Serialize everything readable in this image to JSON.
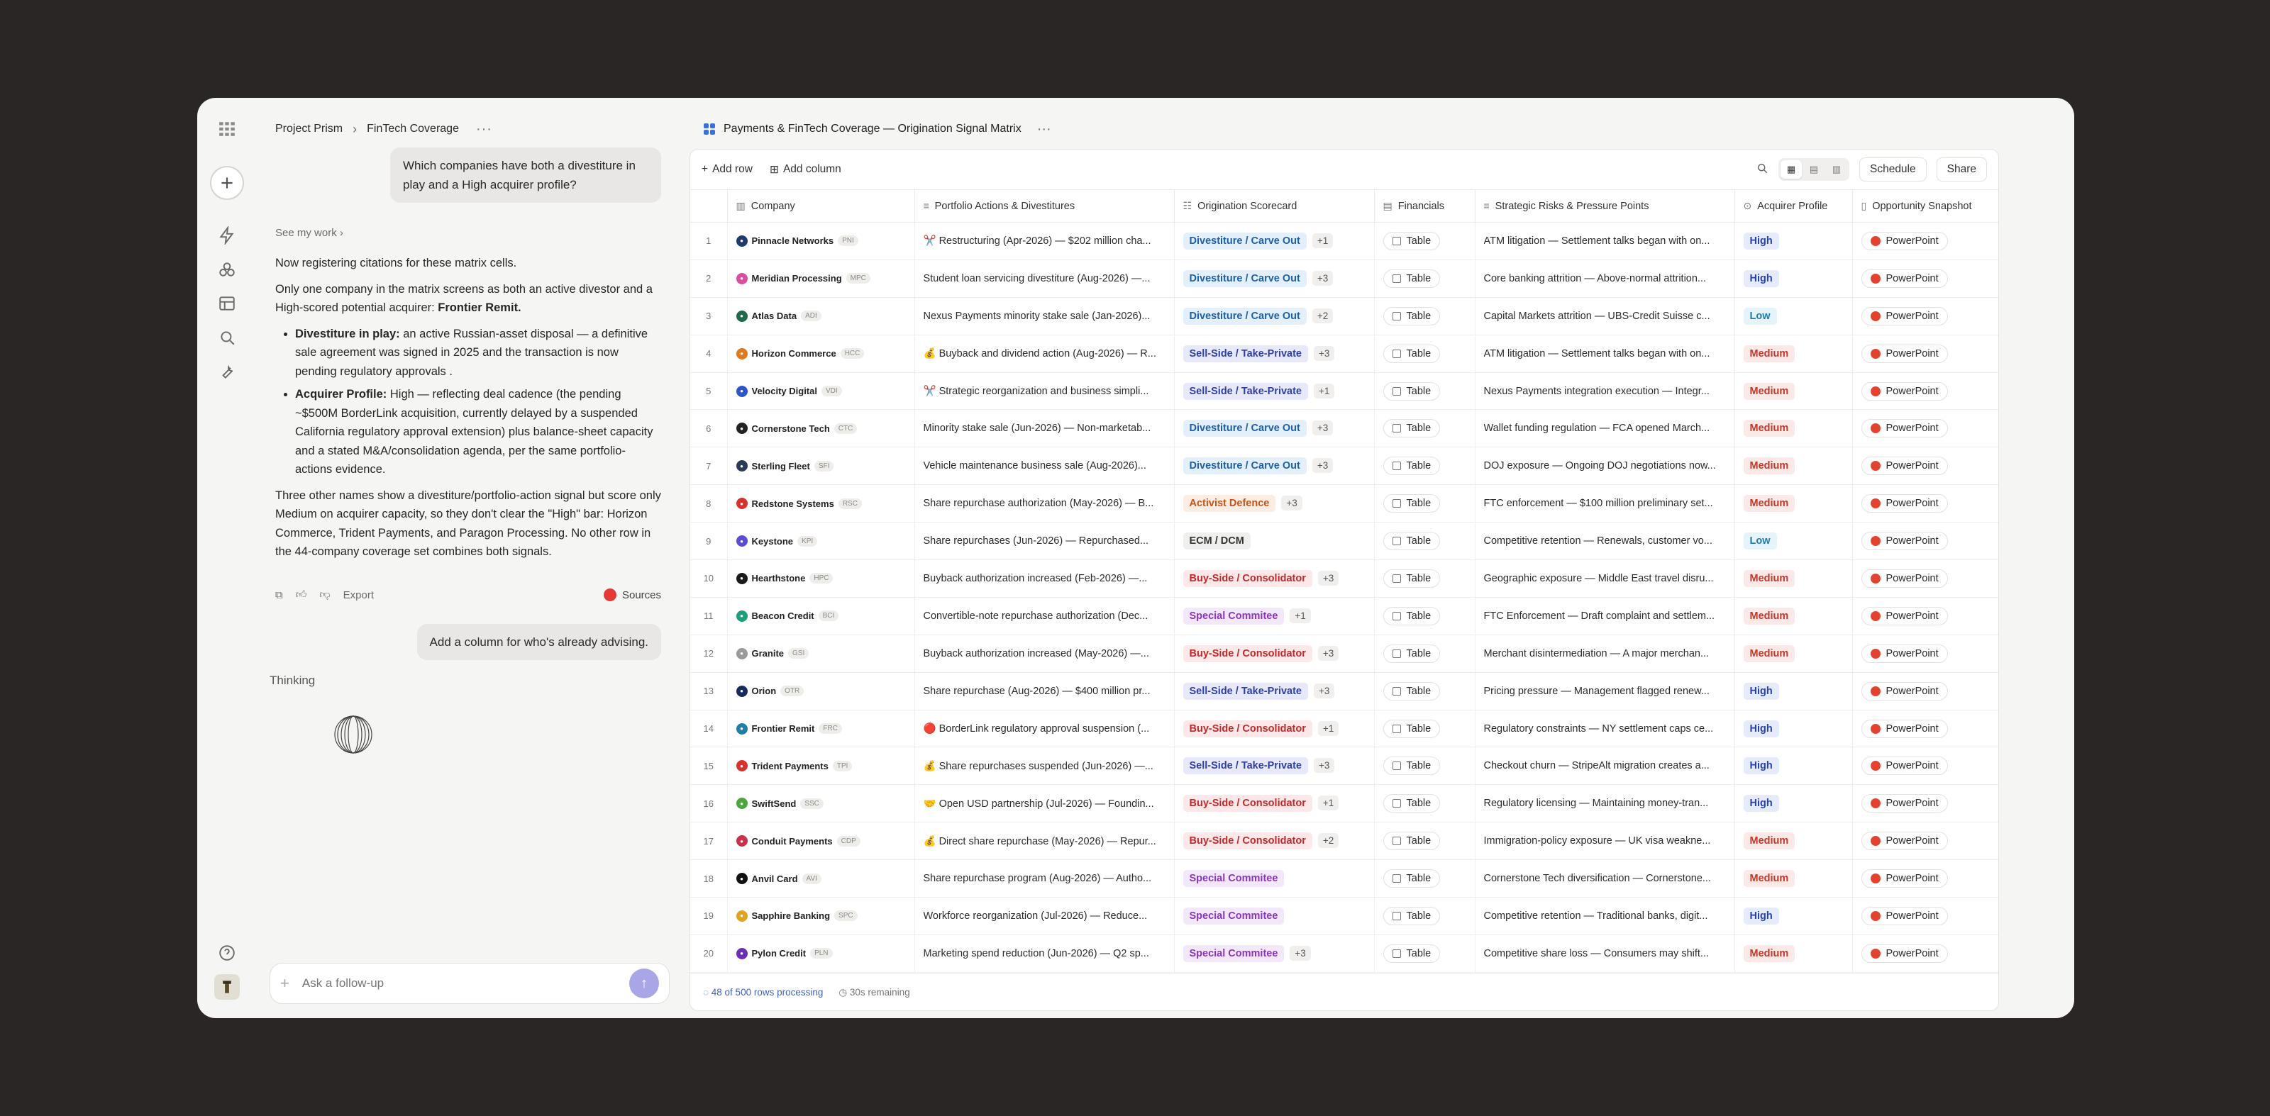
{
  "breadcrumb": {
    "project": "Project Prism",
    "page": "FinTech Coverage"
  },
  "chat": {
    "user_question": "Which companies have both a divestiture in play and a High acquirer profile?",
    "see_my_work": "See my work",
    "p1": "Now registering citations for these matrix cells.",
    "p2_pre": "Only one company in the matrix screens as both an active divestor and a High-scored potential acquirer: ",
    "p2_bold": "Frontier Remit.",
    "b1_bold": "Divestiture in play:",
    "b1_text": " an active Russian-asset disposal — a definitive sale agreement was signed in 2025 and the transaction is now pending regulatory approvals .",
    "b2_bold": "Acquirer Profile:",
    "b2_text": " High  — reflecting deal cadence (the pending ~$500M BorderLink acquisition, currently delayed by a suspended California regulatory approval extension) plus balance-sheet capacity and a stated M&A/consolidation agenda, per the same portfolio-actions evidence.",
    "p3": "Three other names show a divestiture/portfolio-action signal but score only Medium on acquirer capacity, so they don't clear the \"High\" bar: Horizon Commerce, Trident Payments, and Paragon Processing. No other row in the 44-company coverage set combines both signals.",
    "export": "Export",
    "sources": "Sources",
    "user_followup": "Add a column for who's already advising.",
    "thinking": "Thinking",
    "composer_placeholder": "Ask a follow-up"
  },
  "panel": {
    "title": "Payments & FinTech Coverage — Origination Signal Matrix",
    "add_row": "Add row",
    "add_column": "Add column",
    "schedule": "Schedule",
    "share": "Share",
    "columns": [
      "Company",
      "Portfolio Actions & Divestitures",
      "Origination Scorecard",
      "Financials",
      "Strategic Risks & Pressure Points",
      "Acquirer Profile",
      "Opportunity Snapshot"
    ],
    "footer_processing": "48 of 500 rows processing",
    "footer_remaining": "30s remaining"
  },
  "rows": [
    {
      "n": "1",
      "name": "Pinnacle Networks",
      "tick": "PNI",
      "color": "#1f3a6e",
      "pa": "✂️ Restructuring (Apr-2026) — $202 million cha...",
      "score": "Divestiture / Carve Out",
      "cls": "p-div",
      "more": "+1",
      "fin": "Table",
      "risk": "ATM litigation — Settlement talks began with on...",
      "acq": "High",
      "acls": "a-high",
      "snap": "PowerPoint"
    },
    {
      "n": "2",
      "name": "Meridian Processing",
      "tick": "MPC",
      "color": "#d94fa0",
      "pa": "Student loan servicing divestiture (Aug-2026) —...",
      "score": "Divestiture / Carve Out",
      "cls": "p-div",
      "more": "+3",
      "fin": "Table",
      "risk": "Core banking attrition — Above-normal attrition...",
      "acq": "High",
      "acls": "a-high",
      "snap": "PowerPoint"
    },
    {
      "n": "3",
      "name": "Atlas Data",
      "tick": "ADI",
      "color": "#1d6b4a",
      "pa": "Nexus Payments minority stake sale (Jan-2026)...",
      "score": "Divestiture / Carve Out",
      "cls": "p-div",
      "more": "+2",
      "fin": "Table",
      "risk": "Capital Markets attrition — UBS-Credit Suisse c...",
      "acq": "Low",
      "acls": "a-low",
      "snap": "PowerPoint"
    },
    {
      "n": "4",
      "name": "Horizon Commerce",
      "tick": "HCC",
      "color": "#e07a1f",
      "pa": "💰 Buyback and dividend action (Aug-2026) — R...",
      "score": "Sell-Side / Take-Private",
      "cls": "p-sell",
      "more": "+3",
      "fin": "Table",
      "risk": "ATM litigation — Settlement talks began with on...",
      "acq": "Medium",
      "acls": "a-med",
      "snap": "PowerPoint"
    },
    {
      "n": "5",
      "name": "Velocity Digital",
      "tick": "VDI",
      "color": "#2c56c9",
      "pa": "✂️ Strategic reorganization and business simpli...",
      "score": "Sell-Side / Take-Private",
      "cls": "p-sell",
      "more": "+1",
      "fin": "Table",
      "risk": "Nexus Payments integration execution — Integr...",
      "acq": "Medium",
      "acls": "a-med",
      "snap": "PowerPoint"
    },
    {
      "n": "6",
      "name": "Cornerstone Tech",
      "tick": "CTC",
      "color": "#222222",
      "pa": "Minority stake sale (Jun-2026) — Non-marketab...",
      "score": "Divestiture / Carve Out",
      "cls": "p-div",
      "more": "+3",
      "fin": "Table",
      "risk": "Wallet funding regulation — FCA opened March...",
      "acq": "Medium",
      "acls": "a-med",
      "snap": "PowerPoint"
    },
    {
      "n": "7",
      "name": "Sterling Fleet",
      "tick": "SFI",
      "color": "#2b3b55",
      "pa": "Vehicle maintenance business sale (Aug-2026)...",
      "score": "Divestiture / Carve Out",
      "cls": "p-div",
      "more": "+3",
      "fin": "Table",
      "risk": "DOJ exposure — Ongoing DOJ negotiations now...",
      "acq": "Medium",
      "acls": "a-med",
      "snap": "PowerPoint"
    },
    {
      "n": "8",
      "name": "Redstone Systems",
      "tick": "RSC",
      "color": "#d8322c",
      "pa": "Share repurchase authorization (May-2026) — B...",
      "score": "Activist Defence",
      "cls": "p-act",
      "more": "+3",
      "fin": "Table",
      "risk": "FTC enforcement — $100 million preliminary set...",
      "acq": "Medium",
      "acls": "a-med",
      "snap": "PowerPoint"
    },
    {
      "n": "9",
      "name": "Keystone",
      "tick": "KPI",
      "color": "#5b4bd6",
      "pa": "Share repurchases (Jun-2026) — Repurchased...",
      "score": "ECM / DCM",
      "cls": "p-ecm",
      "more": "",
      "fin": "Table",
      "risk": "Competitive retention — Renewals, customer vo...",
      "acq": "Low",
      "acls": "a-low",
      "snap": "PowerPoint"
    },
    {
      "n": "10",
      "name": "Hearthstone",
      "tick": "HPC",
      "color": "#1a1a1a",
      "pa": "Buyback authorization increased (Feb-2026) —...",
      "score": "Buy-Side / Consolidator",
      "cls": "p-buy",
      "more": "+3",
      "fin": "Table",
      "risk": "Geographic exposure — Middle East travel disru...",
      "acq": "Medium",
      "acls": "a-med",
      "snap": "PowerPoint"
    },
    {
      "n": "11",
      "name": "Beacon Credit",
      "tick": "BCI",
      "color": "#1e9e7a",
      "pa": "Convertible-note repurchase authorization (Dec...",
      "score": "Special Commitee",
      "cls": "p-spec",
      "more": "+1",
      "fin": "Table",
      "risk": "FTC Enforcement — Draft complaint and settlem...",
      "acq": "Medium",
      "acls": "a-med",
      "snap": "PowerPoint"
    },
    {
      "n": "12",
      "name": "Granite",
      "tick": "GSI",
      "color": "#9a9a9a",
      "pa": "Buyback authorization increased (May-2026) —...",
      "score": "Buy-Side / Consolidator",
      "cls": "p-buy",
      "more": "+3",
      "fin": "Table",
      "risk": "Merchant disintermediation — A major merchan...",
      "acq": "Medium",
      "acls": "a-med",
      "snap": "PowerPoint"
    },
    {
      "n": "13",
      "name": "Orion",
      "tick": "OTR",
      "color": "#1b2a5c",
      "pa": "Share repurchase (Aug-2026) — $400 million pr...",
      "score": "Sell-Side / Take-Private",
      "cls": "p-sell",
      "more": "+3",
      "fin": "Table",
      "risk": "Pricing pressure — Management flagged renew...",
      "acq": "High",
      "acls": "a-high",
      "snap": "PowerPoint"
    },
    {
      "n": "14",
      "name": "Frontier Remit",
      "tick": "FRC",
      "color": "#1f7fa8",
      "pa": "🔴 BorderLink regulatory approval suspension (...",
      "score": "Buy-Side / Consolidator",
      "cls": "p-buy",
      "more": "+1",
      "fin": "Table",
      "risk": "Regulatory constraints — NY settlement caps ce...",
      "acq": "High",
      "acls": "a-high",
      "snap": "PowerPoint"
    },
    {
      "n": "15",
      "name": "Trident Payments",
      "tick": "TPI",
      "color": "#d8322c",
      "pa": "💰 Share repurchases suspended (Jun-2026) —...",
      "score": "Sell-Side / Take-Private",
      "cls": "p-sell",
      "more": "+3",
      "fin": "Table",
      "risk": "Checkout churn — StripeAlt migration creates a...",
      "acq": "High",
      "acls": "a-high",
      "snap": "PowerPoint"
    },
    {
      "n": "16",
      "name": "SwiftSend",
      "tick": "SSC",
      "color": "#4aa83a",
      "pa": "🤝 Open USD partnership (Jul-2026) — Foundin...",
      "score": "Buy-Side / Consolidator",
      "cls": "p-buy",
      "more": "+1",
      "fin": "Table",
      "risk": "Regulatory licensing — Maintaining money-tran...",
      "acq": "High",
      "acls": "a-high",
      "snap": "PowerPoint"
    },
    {
      "n": "17",
      "name": "Conduit Payments",
      "tick": "CDP",
      "color": "#c8324a",
      "pa": "💰 Direct share repurchase (May-2026) — Repur...",
      "score": "Buy-Side / Consolidator",
      "cls": "p-buy",
      "more": "+2",
      "fin": "Table",
      "risk": "Immigration-policy exposure — UK visa weakne...",
      "acq": "Medium",
      "acls": "a-med",
      "snap": "PowerPoint"
    },
    {
      "n": "18",
      "name": "Anvil Card",
      "tick": "AVI",
      "color": "#111111",
      "pa": "Share repurchase program (Aug-2026) — Autho...",
      "score": "Special Commitee",
      "cls": "p-spec",
      "more": "",
      "fin": "Table",
      "risk": "Cornerstone Tech diversification — Cornerstone...",
      "acq": "Medium",
      "acls": "a-med",
      "snap": "PowerPoint"
    },
    {
      "n": "19",
      "name": "Sapphire Banking",
      "tick": "SPC",
      "color": "#e0a21f",
      "pa": "Workforce reorganization (Jul-2026) — Reduce...",
      "score": "Special Commitee",
      "cls": "p-spec",
      "more": "",
      "fin": "Table",
      "risk": "Competitive retention — Traditional banks, digit...",
      "acq": "High",
      "acls": "a-high",
      "snap": "PowerPoint"
    },
    {
      "n": "20",
      "name": "Pylon Credit",
      "tick": "PLN",
      "color": "#6a2fb8",
      "pa": "Marketing spend reduction (Jun-2026) — Q2 sp...",
      "score": "Special Commitee",
      "cls": "p-spec",
      "more": "+3",
      "fin": "Table",
      "risk": "Competitive share loss — Consumers may shift...",
      "acq": "Medium",
      "acls": "a-med",
      "snap": "PowerPoint"
    }
  ]
}
